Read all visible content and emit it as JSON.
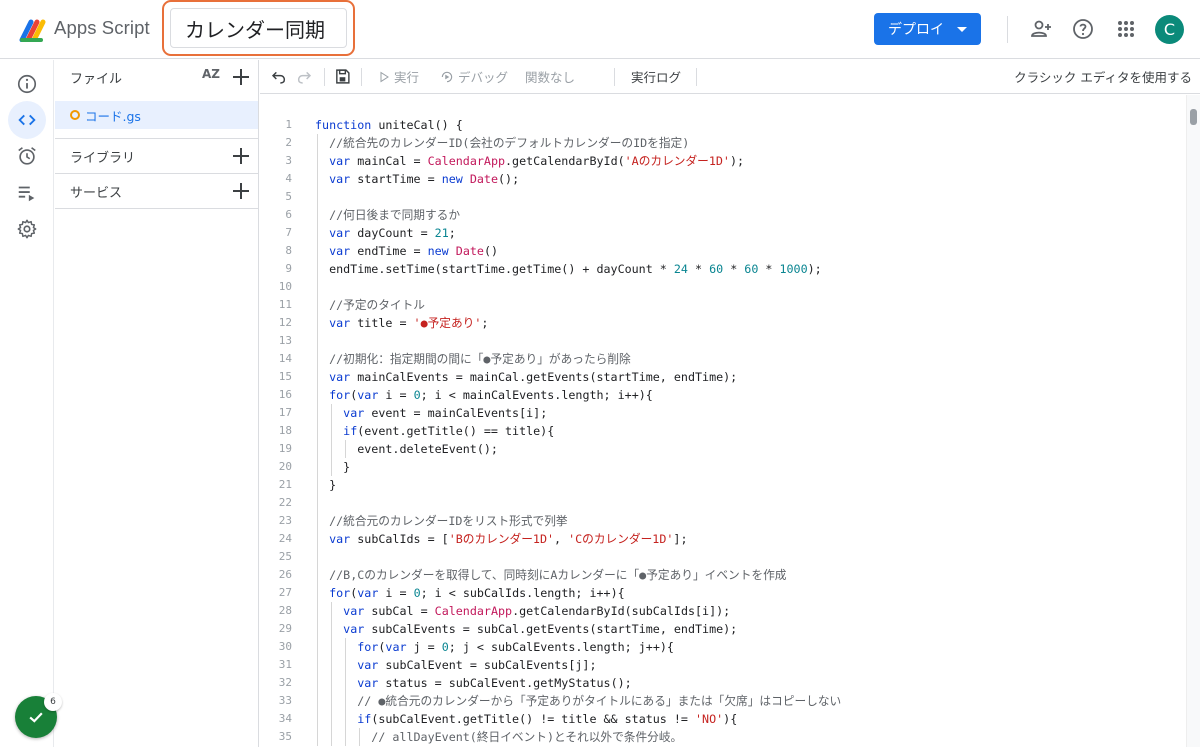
{
  "app": {
    "name": "Apps Script",
    "project_title": "カレンダー同期",
    "user_initial": "C"
  },
  "header": {
    "deploy_label": "デプロイ"
  },
  "colors": {
    "accent": "#1a73e8",
    "highlight_border": "#e8703a",
    "success": "#188038",
    "avatar": "#0b8a7a"
  },
  "rail": {
    "badge_count": "6"
  },
  "files": {
    "header_label": "ファイル",
    "sort_label": "AZ",
    "items": [
      {
        "name": "コード.gs"
      }
    ],
    "sections": [
      {
        "label": "ライブラリ"
      },
      {
        "label": "サービス"
      }
    ]
  },
  "toolbar": {
    "run_label": "実行",
    "debug_label": "デバッグ",
    "function_label": "関数なし",
    "log_label": "実行ログ",
    "classic_label": "クラシック エディタを使用する"
  },
  "editor": {
    "lines": [
      "function uniteCal() {",
      "  //統合先のカレンダーID(会社のデフォルトカレンダーのIDを指定)",
      "  var mainCal = CalendarApp.getCalendarById('Aのカレンダー1D');",
      "  var startTime = new Date();",
      "",
      "  //何日後まで同期するか",
      "  var dayCount = 21;",
      "  var endTime = new Date()",
      "  endTime.setTime(startTime.getTime() + dayCount * 24 * 60 * 60 * 1000);",
      "",
      "  //予定のタイトル",
      "  var title = '●予定あり';",
      "",
      "  //初期化：指定期間の間に「●予定あり」があったら削除",
      "  var mainCalEvents = mainCal.getEvents(startTime, endTime);",
      "  for(var i = 0; i < mainCalEvents.length; i++){",
      "    var event = mainCalEvents[i];",
      "    if(event.getTitle() == title){",
      "      event.deleteEvent();",
      "    }",
      "  }",
      "",
      "  //統合元のカレンダーIDをリスト形式で列挙",
      "  var subCalIds = ['Bのカレンダー1D', 'Cのカレンダー1D'];",
      "",
      "  //B,Cのカレンダーを取得して、同時刻にAカレンダーに「●予定あり」イベントを作成",
      "  for(var i = 0; i < subCalIds.length; i++){",
      "    var subCal = CalendarApp.getCalendarById(subCalIds[i]);",
      "    var subCalEvents = subCal.getEvents(startTime, endTime);",
      "      for(var j = 0; j < subCalEvents.length; j++){",
      "      var subCalEvent = subCalEvents[j];",
      "      var status = subCalEvent.getMyStatus();",
      "      // ●統合元のカレンダーから「予定ありがタイトルにある」または「欠席」はコピーしない",
      "      if(subCalEvent.getTitle() != title && status != 'NO'){",
      "        // allDayEvent(終日イベント)とそれ以外で条件分岐。"
    ]
  }
}
